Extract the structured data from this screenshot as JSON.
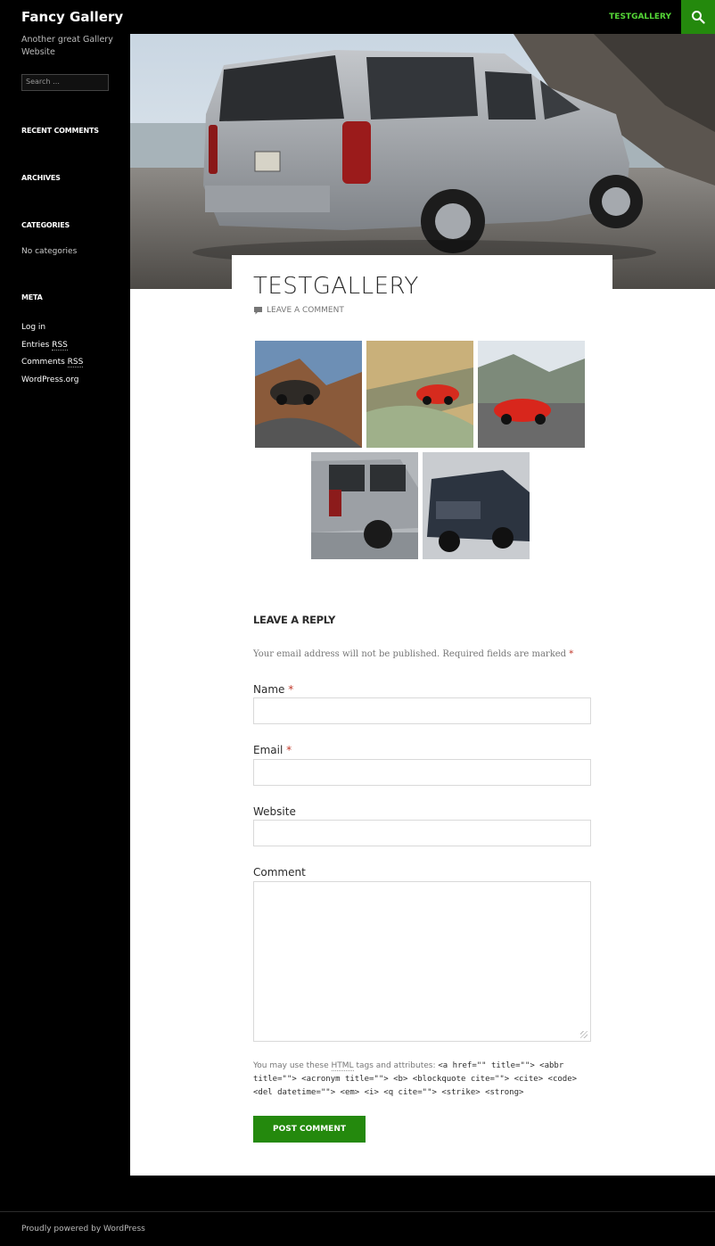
{
  "header": {
    "site_title": "Fancy Gallery",
    "nav_link": "TESTGALLERY",
    "search_icon": "search-icon"
  },
  "sidebar": {
    "tagline": "Another great Gallery Website",
    "search_placeholder": "Search …",
    "recent_comments_title": "RECENT COMMENTS",
    "archives_title": "ARCHIVES",
    "categories_title": "CATEGORIES",
    "categories_empty": "No categories",
    "meta_title": "META",
    "meta_items": [
      {
        "label": "Log in"
      },
      {
        "label": "Entries ",
        "abbr": "RSS"
      },
      {
        "label": "Comments ",
        "abbr": "RSS"
      },
      {
        "label": "WordPress.org"
      }
    ]
  },
  "post": {
    "title": "TESTGALLERY",
    "leave_comment": "LEAVE A COMMENT",
    "comment_icon": "comment-bubble-icon"
  },
  "comment_form": {
    "title": "LEAVE A REPLY",
    "notes": "Your email address will not be published. Required fields are marked",
    "required_mark": "*",
    "name_label": "Name",
    "email_label": "Email",
    "website_label": "Website",
    "comment_label": "Comment",
    "allowed_prefix": "You may use these",
    "allowed_html": "HTML",
    "allowed_mid": "tags and attributes:",
    "allowed_tags": "<a href=\"\" title=\"\"> <abbr title=\"\"> <acronym title=\"\"> <b> <blockquote cite=\"\"> <cite> <code> <del datetime=\"\"> <em> <i> <q cite=\"\"> <strike> <strong>",
    "submit_label": "POST COMMENT"
  },
  "footer": {
    "text": "Proudly powered by WordPress"
  },
  "colors": {
    "accent": "#24890d",
    "nav_link": "#55d737"
  }
}
